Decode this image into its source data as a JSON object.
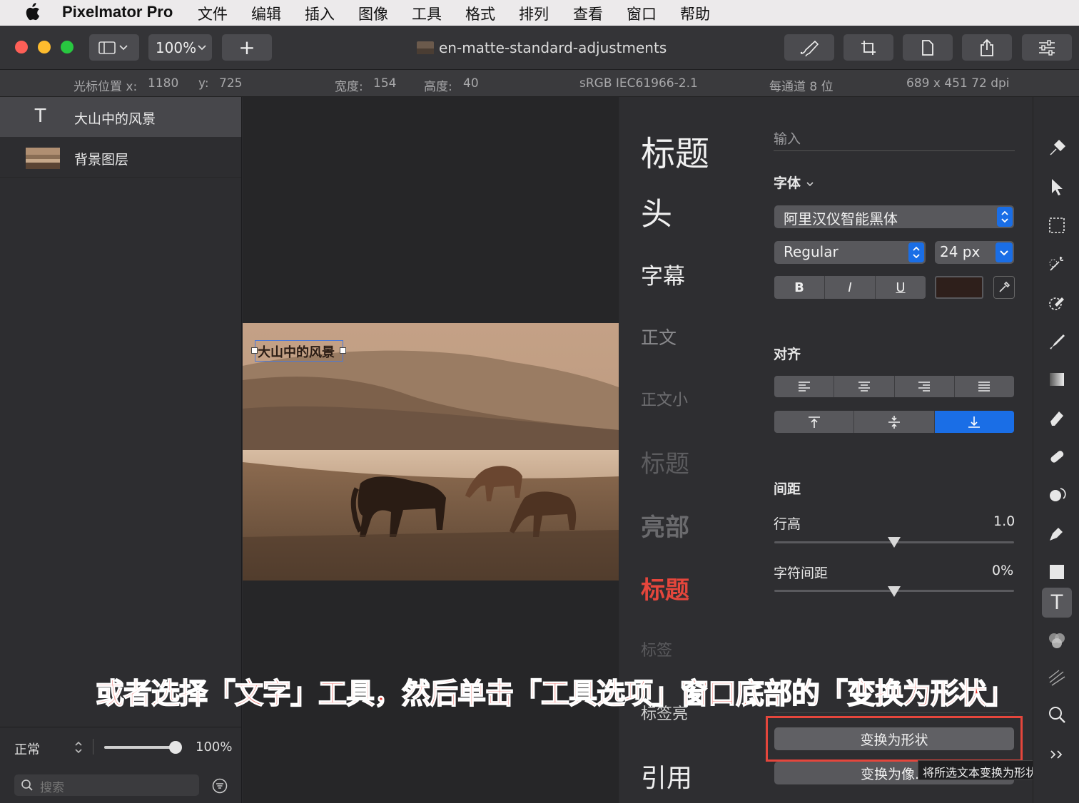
{
  "menubar": {
    "app": "Pixelmator Pro",
    "items": [
      "文件",
      "编辑",
      "插入",
      "图像",
      "工具",
      "格式",
      "排列",
      "查看",
      "窗口",
      "帮助"
    ]
  },
  "toolbar": {
    "zoom": "100%",
    "add_label": "+",
    "document_title": "en-matte-standard-adjustments"
  },
  "infobar": {
    "cursor_x_label": "光标位置 x:",
    "cursor_x": "1180",
    "cursor_y_label": "y:",
    "cursor_y": "725",
    "width_label": "宽度:",
    "width": "154",
    "height_label": "高度:",
    "height": "40",
    "color_profile": "sRGB IEC61966-2.1",
    "bit_depth": "每通道 8 位",
    "dimensions": "689 x 451 72 dpi"
  },
  "layers": [
    {
      "icon": "text-layer-icon",
      "name": "大山中的风景"
    },
    {
      "icon": "thumbnail",
      "name": "背景图层"
    }
  ],
  "sidebar_footer": {
    "blend_mode": "正常",
    "opacity": "100%",
    "opacity_value": 1.0,
    "search_placeholder": "搜索"
  },
  "canvas": {
    "text_on_image": "大山中的风景"
  },
  "styles": [
    "标题",
    "头",
    "字幕",
    "正文",
    "正文小",
    "标题",
    "亮部",
    "标题",
    "标签",
    "标签亮",
    "引用"
  ],
  "options": {
    "input_label": "输入",
    "font_label": "字体",
    "font_family": "阿里汉仪智能黑体",
    "font_style": "Regular",
    "font_size": "24 px",
    "bold": "B",
    "italic": "I",
    "underline": "U",
    "text_color": "#2e1f1b",
    "align_label": "对齐",
    "spacing_label": "间距",
    "line_height_label": "行高",
    "line_height": "1.0",
    "char_spacing_label": "字符间距",
    "char_spacing": "0%",
    "convert_shape_button": "变换为形状",
    "convert_pixel_button": "变换为像...",
    "tooltip": "将所选文本变换为形状图层"
  },
  "caption": "或者选择「文字」工具，然后单击「工具选项」窗口底部的「变换为形状」",
  "colors": {
    "accent_blue": "#1a6ee6",
    "highlight_red": "#e5463c",
    "panel_bg": "#2e2e31"
  }
}
